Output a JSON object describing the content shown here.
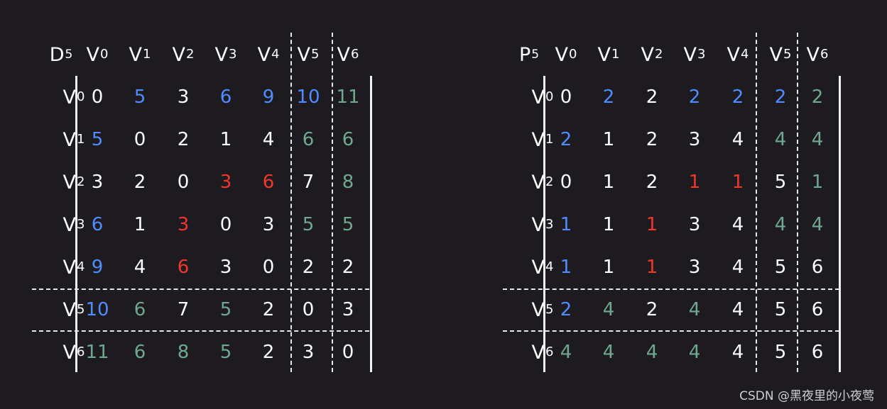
{
  "D": {
    "label": "D",
    "exp": "5",
    "rows": [
      [
        {
          "v": "0",
          "c": "white"
        },
        {
          "v": "5",
          "c": "blue"
        },
        {
          "v": "3",
          "c": "white"
        },
        {
          "v": "6",
          "c": "blue"
        },
        {
          "v": "9",
          "c": "blue"
        },
        {
          "v": "10",
          "c": "blue"
        },
        {
          "v": "11",
          "c": "green"
        }
      ],
      [
        {
          "v": "5",
          "c": "blue"
        },
        {
          "v": "0",
          "c": "white"
        },
        {
          "v": "2",
          "c": "white"
        },
        {
          "v": "1",
          "c": "white"
        },
        {
          "v": "4",
          "c": "white"
        },
        {
          "v": "6",
          "c": "green"
        },
        {
          "v": "6",
          "c": "green"
        }
      ],
      [
        {
          "v": "3",
          "c": "white"
        },
        {
          "v": "2",
          "c": "white"
        },
        {
          "v": "0",
          "c": "white"
        },
        {
          "v": "3",
          "c": "red"
        },
        {
          "v": "6",
          "c": "red"
        },
        {
          "v": "7",
          "c": "white"
        },
        {
          "v": "8",
          "c": "green"
        }
      ],
      [
        {
          "v": "6",
          "c": "blue"
        },
        {
          "v": "1",
          "c": "white"
        },
        {
          "v": "3",
          "c": "red"
        },
        {
          "v": "0",
          "c": "white"
        },
        {
          "v": "3",
          "c": "white"
        },
        {
          "v": "5",
          "c": "green"
        },
        {
          "v": "5",
          "c": "green"
        }
      ],
      [
        {
          "v": "9",
          "c": "blue"
        },
        {
          "v": "4",
          "c": "white"
        },
        {
          "v": "6",
          "c": "red"
        },
        {
          "v": "3",
          "c": "white"
        },
        {
          "v": "0",
          "c": "white"
        },
        {
          "v": "2",
          "c": "white"
        },
        {
          "v": "2",
          "c": "white"
        }
      ],
      [
        {
          "v": "10",
          "c": "blue"
        },
        {
          "v": "6",
          "c": "green"
        },
        {
          "v": "7",
          "c": "white"
        },
        {
          "v": "5",
          "c": "green"
        },
        {
          "v": "2",
          "c": "white"
        },
        {
          "v": "0",
          "c": "white"
        },
        {
          "v": "3",
          "c": "white"
        }
      ],
      [
        {
          "v": "11",
          "c": "green"
        },
        {
          "v": "6",
          "c": "green"
        },
        {
          "v": "8",
          "c": "green"
        },
        {
          "v": "5",
          "c": "green"
        },
        {
          "v": "2",
          "c": "white"
        },
        {
          "v": "3",
          "c": "white"
        },
        {
          "v": "0",
          "c": "white"
        }
      ]
    ]
  },
  "P": {
    "label": "P",
    "exp": "5",
    "rows": [
      [
        {
          "v": "0",
          "c": "white"
        },
        {
          "v": "2",
          "c": "blue"
        },
        {
          "v": "2",
          "c": "white"
        },
        {
          "v": "2",
          "c": "blue"
        },
        {
          "v": "2",
          "c": "blue"
        },
        {
          "v": "2",
          "c": "blue"
        },
        {
          "v": "2",
          "c": "green"
        }
      ],
      [
        {
          "v": "2",
          "c": "blue"
        },
        {
          "v": "1",
          "c": "white"
        },
        {
          "v": "2",
          "c": "white"
        },
        {
          "v": "3",
          "c": "white"
        },
        {
          "v": "4",
          "c": "white"
        },
        {
          "v": "4",
          "c": "green"
        },
        {
          "v": "4",
          "c": "green"
        }
      ],
      [
        {
          "v": "0",
          "c": "white"
        },
        {
          "v": "1",
          "c": "white"
        },
        {
          "v": "2",
          "c": "white"
        },
        {
          "v": "1",
          "c": "red"
        },
        {
          "v": "1",
          "c": "red"
        },
        {
          "v": "5",
          "c": "white"
        },
        {
          "v": "1",
          "c": "green"
        }
      ],
      [
        {
          "v": "1",
          "c": "blue"
        },
        {
          "v": "1",
          "c": "white"
        },
        {
          "v": "1",
          "c": "red"
        },
        {
          "v": "3",
          "c": "white"
        },
        {
          "v": "4",
          "c": "white"
        },
        {
          "v": "4",
          "c": "green"
        },
        {
          "v": "4",
          "c": "green"
        }
      ],
      [
        {
          "v": "1",
          "c": "blue"
        },
        {
          "v": "1",
          "c": "white"
        },
        {
          "v": "1",
          "c": "red"
        },
        {
          "v": "3",
          "c": "white"
        },
        {
          "v": "4",
          "c": "white"
        },
        {
          "v": "5",
          "c": "white"
        },
        {
          "v": "6",
          "c": "white"
        }
      ],
      [
        {
          "v": "2",
          "c": "blue"
        },
        {
          "v": "4",
          "c": "green"
        },
        {
          "v": "2",
          "c": "white"
        },
        {
          "v": "4",
          "c": "green"
        },
        {
          "v": "4",
          "c": "white"
        },
        {
          "v": "5",
          "c": "white"
        },
        {
          "v": "6",
          "c": "white"
        }
      ],
      [
        {
          "v": "4",
          "c": "green"
        },
        {
          "v": "4",
          "c": "green"
        },
        {
          "v": "4",
          "c": "green"
        },
        {
          "v": "4",
          "c": "green"
        },
        {
          "v": "4",
          "c": "white"
        },
        {
          "v": "5",
          "c": "white"
        },
        {
          "v": "6",
          "c": "white"
        }
      ]
    ]
  },
  "vertex_letter": "V",
  "vertex_indices": [
    "0",
    "1",
    "2",
    "3",
    "4",
    "5",
    "6"
  ],
  "colors": {
    "white": "#ffffff",
    "blue": "#4f8dff",
    "red": "#f0372c",
    "green": "#6fa88f",
    "background": "#1d1b20"
  },
  "watermark": "CSDN @黑夜里的小夜莺"
}
